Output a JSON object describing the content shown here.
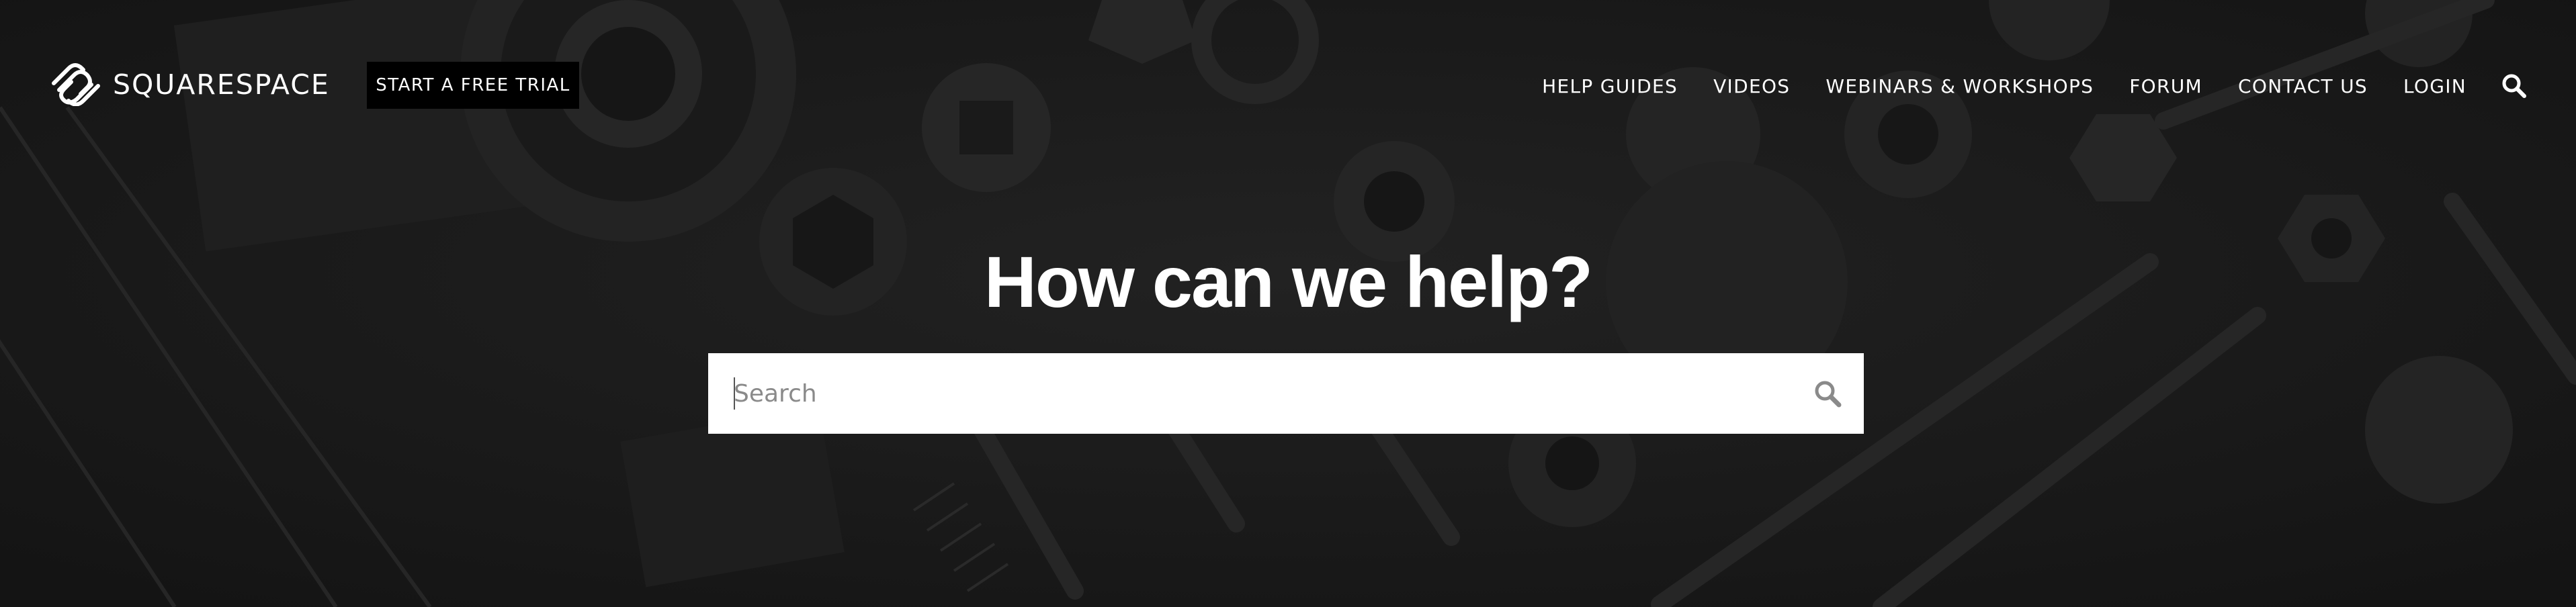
{
  "colors": {
    "background": "#1b1b1b",
    "text": "#ffffff",
    "button_bg": "#000000",
    "search_bg": "#ffffff",
    "search_icon": "#8a8a8a"
  },
  "header": {
    "logo_text": "SQUARESPACE",
    "logo_icon": "squarespace-logo-icon",
    "trial_button": "START A FREE TRIAL",
    "nav": [
      {
        "label": "HELP GUIDES"
      },
      {
        "label": "VIDEOS"
      },
      {
        "label": "WEBINARS & WORKSHOPS"
      },
      {
        "label": "FORUM"
      },
      {
        "label": "CONTACT US"
      },
      {
        "label": "LOGIN"
      }
    ],
    "search_icon": "search-icon"
  },
  "hero": {
    "title": "How can we help?",
    "search": {
      "placeholder": "Search",
      "value": "",
      "submit_icon": "search-icon"
    }
  }
}
